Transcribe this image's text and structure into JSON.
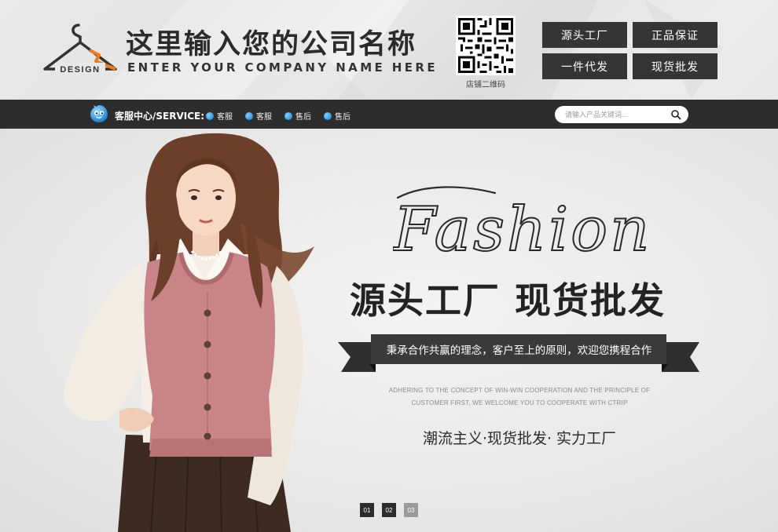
{
  "header": {
    "logo_text": "DESIGN",
    "company_name_cn": "这里输入您的公司名称",
    "company_name_en": "ENTER YOUR COMPANY NAME HERE",
    "qr_caption": "店铺二维码",
    "buttons": [
      "源头工厂",
      "正品保证",
      "一件代发",
      "现货批发"
    ]
  },
  "nav": {
    "service_label": "客服中心/SERVICE:",
    "links": [
      "客服",
      "客服",
      "售后",
      "售后"
    ],
    "search_placeholder": "请输入产品关键词..."
  },
  "banner": {
    "script_word": "Fashion",
    "slogan": "源头工厂  现货批发",
    "ribbon_text": "秉承合作共赢的理念，客户至上的原则，欢迎您携程合作",
    "en_line1": "ADHERING TO THE CONCEPT OF WIN-WIN COOPERATION AND THE PRINCIPLE OF",
    "en_line2": "CUSTOMER FIRST, WE WELCOME YOU TO COOPERATE WITH CTRIP",
    "tagline": "潮流主义·现货批发· 实力工厂",
    "pager": [
      "01",
      "02",
      "03"
    ],
    "active_page": "03"
  },
  "colors": {
    "dark": "#2d2d2d",
    "button": "#353535",
    "logo_accent": "#f07a1c",
    "pager_active": "#9a9a9a"
  }
}
